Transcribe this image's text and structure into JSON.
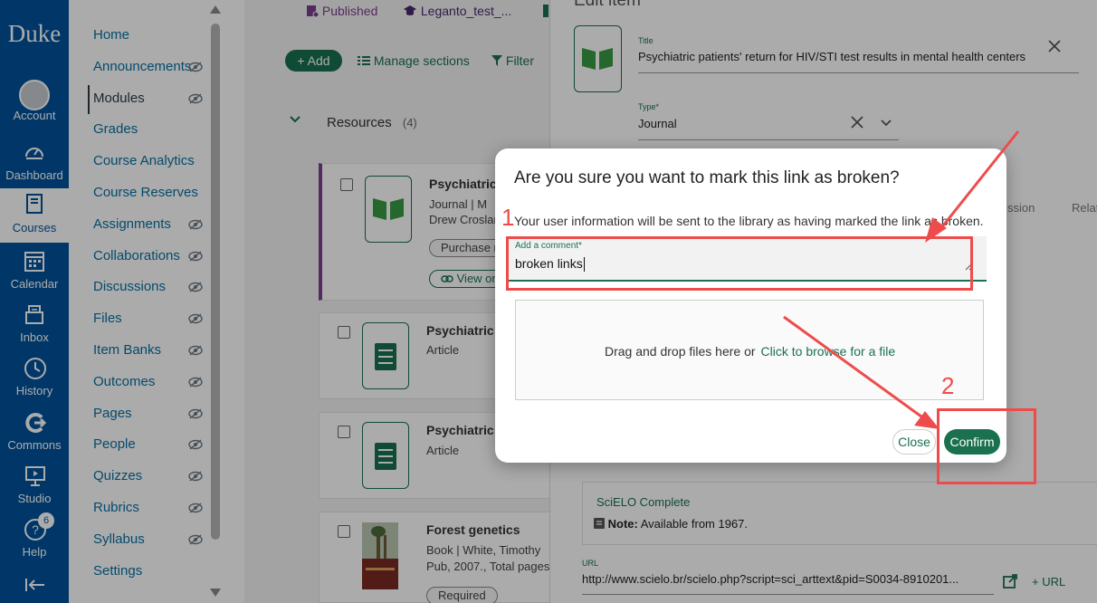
{
  "global_nav": {
    "logo": "Duke",
    "items": [
      {
        "label": "Account",
        "icon": "account-icon"
      },
      {
        "label": "Dashboard",
        "icon": "dashboard-icon"
      },
      {
        "label": "Courses",
        "icon": "courses-icon"
      },
      {
        "label": "Calendar",
        "icon": "calendar-icon"
      },
      {
        "label": "Inbox",
        "icon": "inbox-icon"
      },
      {
        "label": "History",
        "icon": "history-icon"
      },
      {
        "label": "Commons",
        "icon": "commons-icon"
      },
      {
        "label": "Studio",
        "icon": "studio-icon"
      },
      {
        "label": "Help",
        "icon": "help-icon"
      }
    ],
    "help_badge": "6",
    "collapse_icon": "collapse-nav-icon"
  },
  "course_nav": {
    "items": [
      "Home",
      "Announcements",
      "Modules",
      "Grades",
      "Course Analytics",
      "Course Reserves",
      "Assignments",
      "Collaborations",
      "Discussions",
      "Files",
      "Item Banks",
      "Outcomes",
      "Pages",
      "People",
      "Quizzes",
      "Rubrics",
      "Syllabus",
      "Settings"
    ],
    "active": "Modules"
  },
  "main": {
    "topbar": {
      "published": "Published",
      "leganto": "Leganto_test_..."
    },
    "add_label": "+ Add",
    "manage_label": "Manage sections",
    "filter_label": "Filter",
    "section": {
      "title": "Resources",
      "count": "(4)"
    },
    "cards": [
      {
        "title": "Psychiatric",
        "line1": "Journal  |  M",
        "line2": "Drew Croslan",
        "pill1": "Purchase r",
        "pill2": "View onl"
      },
      {
        "title": "Psychiatric",
        "line1": "Article"
      },
      {
        "title": "Psychiatric",
        "line1": "Article"
      },
      {
        "title": "Forest genetics",
        "line1": "Book  |  White, Timothy",
        "line2": "Pub, 2007., Total pages",
        "pill1": "Required"
      }
    ]
  },
  "panel": {
    "heading": "Edit item",
    "title_label": "Title",
    "title_value": "Psychiatric patients' return for HIV/STI test results in mental health centers",
    "type_label": "Type*",
    "type_value": "Journal",
    "tab_partial_1": "ssion",
    "tab_partial_2": "Relat",
    "source": "SciELO Complete",
    "note_label": "Note:",
    "note_value": "Available from 1967.",
    "url_label": "URL",
    "url_value": "http://www.scielo.br/scielo.php?script=sci_arttext&pid=S0034-8910201...",
    "add_url": "+ URL"
  },
  "dialog": {
    "title": "Are you sure you want to mark this link as broken?",
    "message": "Your user information will be sent to the library as having marked the link as broken.",
    "comment_label": "Add a comment*",
    "comment_value": "broken links",
    "dropzone_text": "Drag and drop files here or",
    "dropzone_link": "Click to browse for a file",
    "close_label": "Close",
    "confirm_label": "Confirm"
  },
  "annotations": {
    "step1": "1",
    "step2": "2",
    "color": "#ee4c4c"
  },
  "colors": {
    "brand_blue": "#00539b",
    "accent_green": "#19714f",
    "link_blue": "#0770a3"
  }
}
